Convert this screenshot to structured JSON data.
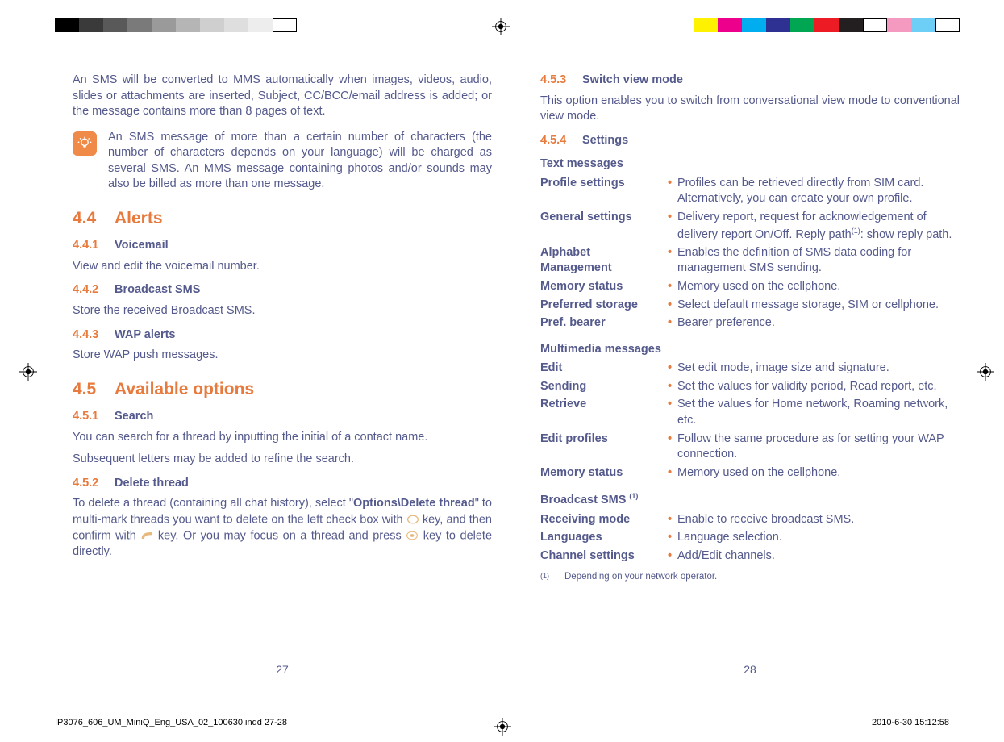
{
  "left": {
    "intro": "An SMS will be converted to MMS automatically when images, videos, audio, slides or attachments are inserted, Subject, CC/BCC/email address is added; or the message contains more than 8 pages of text.",
    "note": "An SMS message of more than a certain number of characters (the number of characters depends on your language) will be charged as several SMS. An MMS message containing photos and/or sounds may also be billed as more than one message.",
    "s44_num": "4.4",
    "s44_title": "Alerts",
    "s441_num": "4.4.1",
    "s441_title": "Voicemail",
    "s441_body": "View and edit the voicemail number.",
    "s442_num": "4.4.2",
    "s442_title": "Broadcast SMS",
    "s442_body": "Store the received Broadcast SMS.",
    "s443_num": "4.4.3",
    "s443_title": "WAP alerts",
    "s443_body": "Store WAP push messages.",
    "s45_num": "4.5",
    "s45_title": "Available options",
    "s451_num": "4.5.1",
    "s451_title": "Search",
    "s451_body1": "You can search for a thread by inputting the initial of a contact name.",
    "s451_body2": "Subsequent letters may be added to refine the search.",
    "s452_num": "4.5.2",
    "s452_title": "Delete thread",
    "s452_pre": "To delete a thread (containing all chat history), select \"",
    "s452_bold": "Options\\Delete thread",
    "s452_mid1": "\" to multi-mark threads you want to delete on the left check box with ",
    "s452_mid2": " key, and then confirm with ",
    "s452_mid3": " key. Or you may focus on a thread and press ",
    "s452_end": " key to delete directly.",
    "page_num": "27"
  },
  "right": {
    "s453_num": "4.5.3",
    "s453_title": "Switch view mode",
    "s453_body": "This option enables you to switch from conversational view mode to conventional view mode.",
    "s454_num": "4.5.4",
    "s454_title": "Settings",
    "grp_text": "Text messages",
    "text_rows": [
      {
        "label": "Profile settings",
        "val": "Profiles can be retrieved directly from SIM card. Alternatively, you can create your own profile."
      },
      {
        "label": "General settings",
        "val": "Delivery report, request for acknowledgement of delivery report On/Off. Reply path",
        "sup": "(1)",
        "val2": ": show reply path."
      },
      {
        "label": "Alphabet Management",
        "val": "Enables the definition of SMS data coding for management SMS sending."
      },
      {
        "label": "Memory status",
        "val": "Memory used on the cellphone."
      },
      {
        "label": "Preferred storage",
        "val": "Select default message storage, SIM or cellphone."
      },
      {
        "label": "Pref. bearer",
        "val": "Bearer preference."
      }
    ],
    "grp_mms": "Multimedia messages",
    "mms_rows": [
      {
        "label": "Edit",
        "val": "Set edit mode, image size and signature."
      },
      {
        "label": "Sending",
        "val": "Set the values for validity period, Read report, etc."
      },
      {
        "label": "Retrieve",
        "val": "Set the values for Home network, Roaming network, etc."
      },
      {
        "label": "Edit profiles",
        "val": "Follow the same procedure as for setting your WAP connection."
      },
      {
        "label": "Memory status",
        "val": "Memory used on the cellphone."
      }
    ],
    "grp_bcast_pre": "Broadcast SMS",
    "grp_bcast_sup": "(1)",
    "bcast_rows": [
      {
        "label": "Receiving mode",
        "val": "Enable to receive broadcast SMS."
      },
      {
        "label": "Languages",
        "val": "Language selection."
      },
      {
        "label": "Channel settings",
        "val": "Add/Edit channels."
      }
    ],
    "footnote_sup": "(1)",
    "footnote": "Depending on your network operator.",
    "page_num": "28"
  },
  "footer": {
    "file": "IP3076_606_UM_MiniQ_Eng_USA_02_100630.indd   27-28",
    "date": "2010-6-30   15:12:58"
  },
  "swatches_left": [
    "#000",
    "#3a3a3a",
    "#595959",
    "#7a7a7a",
    "#9a9a9a",
    "#b5b5b5",
    "#cfcfcf",
    "#dedede",
    "#ededed",
    "#fff"
  ],
  "swatches_right": [
    "#fff200",
    "#ec008c",
    "#00aeef",
    "#2e3192",
    "#00a651",
    "#ed1c24",
    "#231f20",
    "#fff",
    "#f49ac1",
    "#6dcff6",
    "#fff"
  ]
}
